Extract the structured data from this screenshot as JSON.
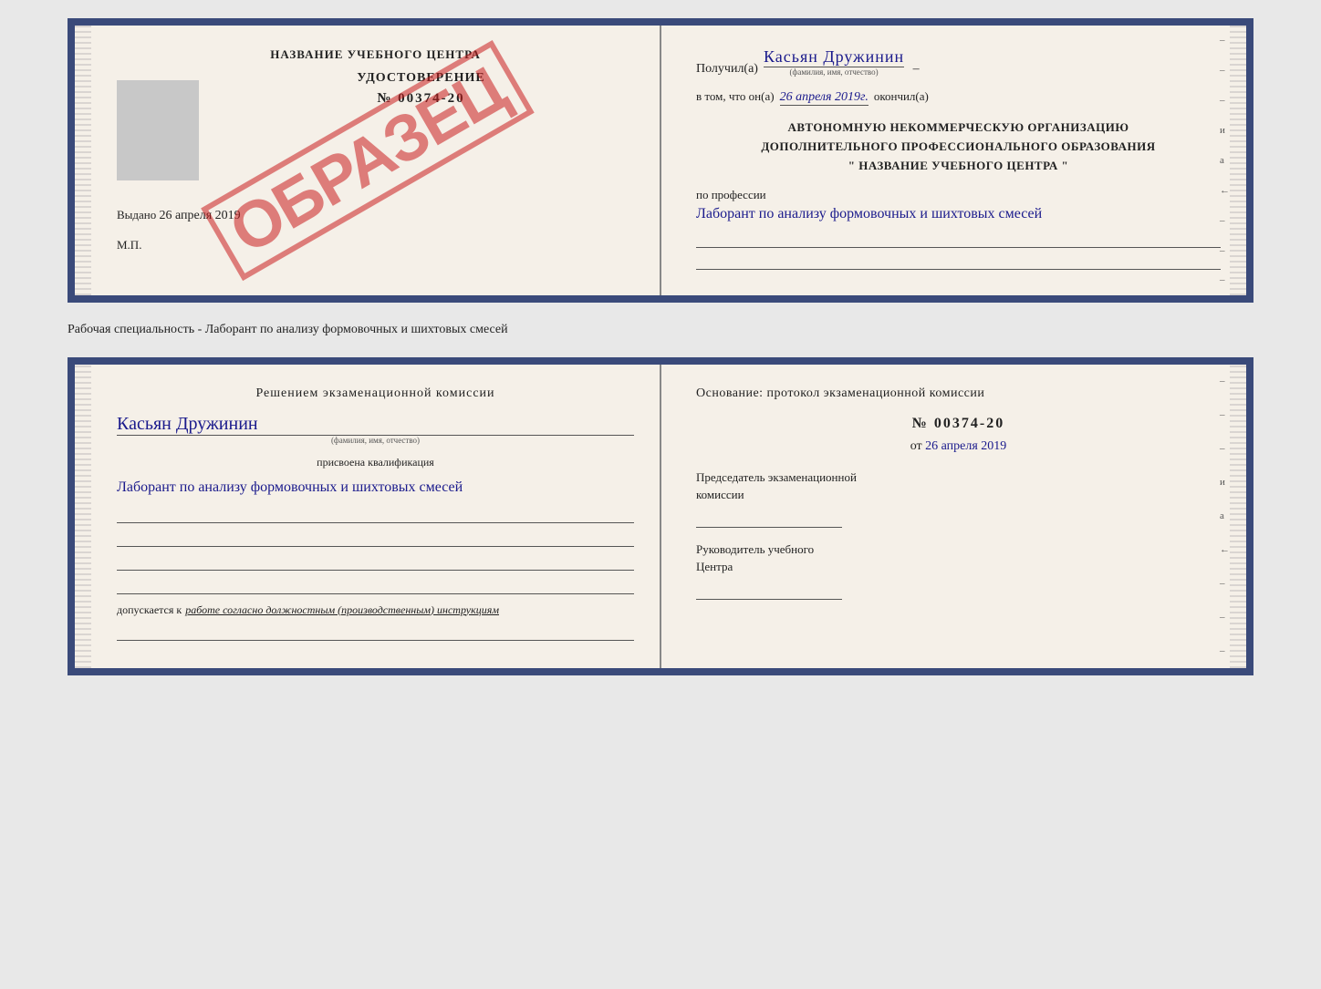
{
  "top": {
    "left": {
      "title": "НАЗВАНИЕ УЧЕБНОГО ЦЕНТРА",
      "cert_label": "УДОСТОВЕРЕНИЕ",
      "cert_number": "№ 00374-20",
      "issued_prefix": "Выдано",
      "issued_date": "26 апреля 2019",
      "mp": "М.П.",
      "stamp": "ОБРАЗЕЦ"
    },
    "right": {
      "received_prefix": "Получил(а)",
      "received_name": "Касьян Дружинин",
      "received_sublabel": "(фамилия, имя, отчество)",
      "vtom_prefix": "в том, что он(а)",
      "vtom_date": "26 апреля 2019г.",
      "vtom_suffix": "окончил(а)",
      "org_line1": "АВТОНОМНУЮ НЕКОММЕРЧЕСКУЮ ОРГАНИЗАЦИЮ",
      "org_line2": "ДОПОЛНИТЕЛЬНОГО ПРОФЕССИОНАЛЬНОГО ОБРАЗОВАНИЯ",
      "org_line3": "\" НАЗВАНИЕ УЧЕБНОГО ЦЕНТРА \"",
      "profession_label": "по профессии",
      "profession_handwritten": "Лаборант по анализу формовочных и шихтовых смесей"
    }
  },
  "separator": "Рабочая специальность - Лаборант по анализу формовочных и шихтовых смесей",
  "bottom": {
    "left": {
      "resolution_title": "Решением экзаменационной комиссии",
      "name_handwritten": "Касьян Дружинин",
      "name_sublabel": "(фамилия, имя, отчество)",
      "qualification_label": "присвоена квалификация",
      "qualification_handwritten": "Лаборант по анализу формовочных и шихтовых смесей",
      "допускается_prefix": "допускается к",
      "допускается_text": "работе согласно должностным (производственным) инструкциям"
    },
    "right": {
      "osnov_title": "Основание: протокол экзаменационной комиссии",
      "protocol_number": "№ 00374-20",
      "protocol_date_prefix": "от",
      "protocol_date": "26 апреля 2019",
      "chairman_line1": "Председатель экзаменационной",
      "chairman_line2": "комиссии",
      "руководитель_line1": "Руководитель учебного",
      "руководитель_line2": "Центра"
    }
  },
  "side_dashes": [
    "-",
    "-",
    "-",
    "и",
    "а",
    "←",
    "-",
    "-",
    "-"
  ]
}
